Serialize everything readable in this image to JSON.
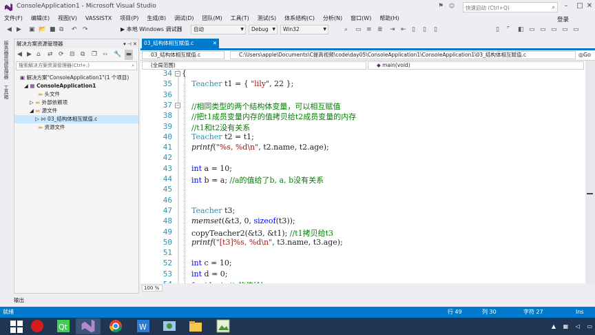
{
  "window": {
    "title": "ConsoleApplication1 - Microsoft Visual Studio",
    "quick_launch_placeholder": "快速启动 (Ctrl+Q)",
    "login": "登录"
  },
  "menu": [
    "文件(F)",
    "编辑(E)",
    "视图(V)",
    "VASSISTX",
    "项目(P)",
    "生成(B)",
    "调试(D)",
    "团队(M)",
    "工具(T)",
    "测试(S)",
    "体系结构(C)",
    "分析(N)",
    "窗口(W)",
    "帮助(H)"
  ],
  "toolbar": {
    "run_label": "▶ 本地 Windows 调试器",
    "config_auto": "自动",
    "config_debug": "Debug",
    "platform": "Win32"
  },
  "left_strip": [
    "服务器资源管理器",
    "工具箱"
  ],
  "solution_explorer": {
    "title": "解决方案资源管理器",
    "search_placeholder": "搜索解决方案资源管理器(Ctrl+;)",
    "items": [
      {
        "label": "解决方案\"ConsoleApplication1\"(1 个项目)",
        "level": 0
      },
      {
        "label": "ConsoleApplication1",
        "level": 1
      },
      {
        "label": "头文件",
        "level": 2
      },
      {
        "label": "外部依赖项",
        "level": 2
      },
      {
        "label": "源文件",
        "level": 2
      },
      {
        "label": "03_结构体相互赋值.c",
        "level": 3
      },
      {
        "label": "资源文件",
        "level": 2
      }
    ]
  },
  "doc_tab": {
    "label": "03_结构体相互赋值.c"
  },
  "nav": {
    "file": "03_结构体相互赋值.c",
    "path": "C:\\Users\\apple\\Documents\\C提高视频\\code\\day05\\ConsoleApplication1\\ConsoleApplication1\\03_结构体相互赋值.c",
    "go": "Go",
    "scope": "(全局范围)",
    "member": "main(void)"
  },
  "code": {
    "line_numbers": [
      "34",
      "35",
      "36",
      "37",
      "38",
      "39",
      "40",
      "41",
      "42",
      "43",
      "44",
      "45",
      "46",
      "47",
      "48",
      "49",
      "50",
      "51",
      "52",
      "53",
      "54"
    ],
    "lines": [
      "{",
      "    Teacher t1 = { \"lily\", 22 };",
      "",
      "    //相同类型的两个结构体变量，可以相互赋值",
      "    //把t1成员变量内存的值拷贝给t2成员变量的内存",
      "    //t1和t2没有关系",
      "    Teacher t2 = t1;",
      "    printf(\"%s, %d\\n\", t2.name, t2.age);",
      "",
      "    int a = 10;",
      "    int b = a; //a的值给了b, a, b没有关系",
      "",
      "",
      "    Teacher t3;",
      "    memset(&t3, 0, sizeof(t3));",
      "    copyTeacher2(&t3, &t1); //t1拷贝给t3",
      "    printf(\"[t3]%s, %d\\n\", t3.name, t3.age);",
      "",
      "    int c = 10;",
      "    int d = 0;",
      "    fun(d, c); //c的值给b"
    ]
  },
  "zoom": "100 %",
  "output_tab": "输出",
  "status": {
    "ready": "就绪",
    "line": "行 49",
    "col": "列 30",
    "char": "字符 27",
    "mode": "Ins"
  },
  "colors": {
    "accent": "#007acc",
    "taskbar": "#1f3553",
    "keyword": "#0000ff",
    "type": "#2b91af",
    "string": "#a31515",
    "comment": "#008000"
  }
}
